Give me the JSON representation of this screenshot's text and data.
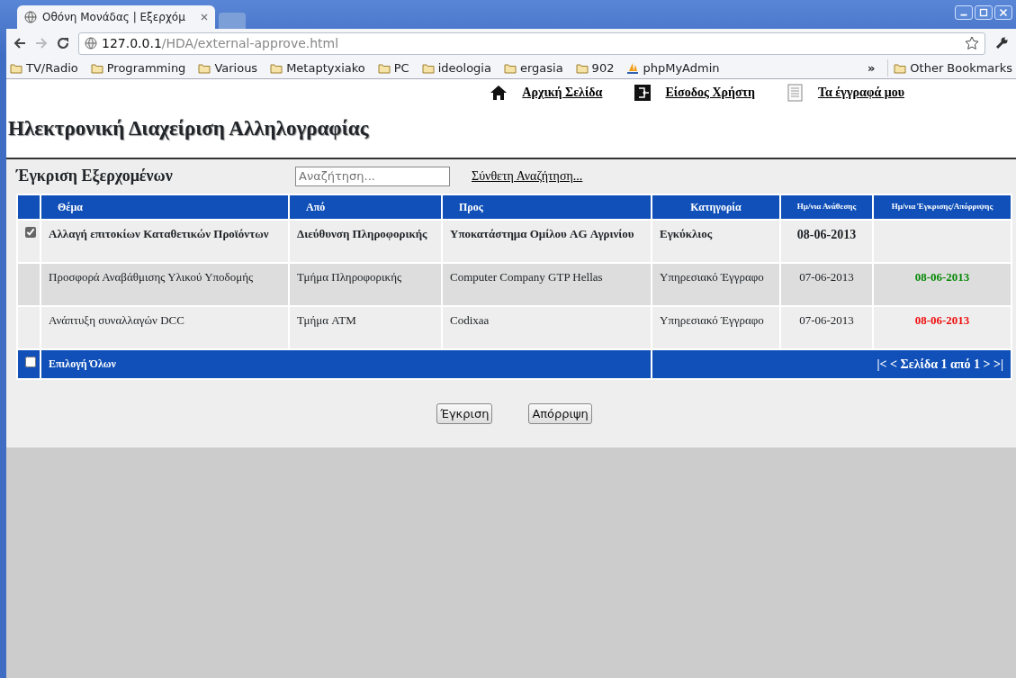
{
  "browser": {
    "tab_title": "Οθόνη Μονάδας | Εξερχόμ",
    "address": {
      "host": "127.0.0.1",
      "path": "/HDA/external-approve.html"
    },
    "bookmarks": [
      {
        "label": "TV/Radio",
        "kind": "folder"
      },
      {
        "label": "Programming",
        "kind": "folder"
      },
      {
        "label": "Various",
        "kind": "folder"
      },
      {
        "label": "Metaptyxiako",
        "kind": "folder"
      },
      {
        "label": "PC",
        "kind": "folder"
      },
      {
        "label": "ideologia",
        "kind": "folder"
      },
      {
        "label": "ergasia",
        "kind": "folder"
      },
      {
        "label": "902",
        "kind": "folder"
      },
      {
        "label": "phpMyAdmin",
        "kind": "app"
      }
    ],
    "overflow": "»",
    "other_bookmarks": "Other Bookmarks"
  },
  "top_nav": [
    {
      "label": "Αρχική Σελίδα",
      "kind": "home"
    },
    {
      "label": "Είσοδος Χρήστη",
      "kind": "login"
    },
    {
      "label": "Τα έγγραφά μου",
      "kind": "documents"
    }
  ],
  "site_title": "Ηλεκτρονική Διαχείριση Αλληλογραφίας",
  "section": {
    "title": "Έγκριση Εξερχομένων",
    "search": {
      "placeholder": "Αναζήτηση..."
    },
    "advanced_search": "Σύνθετη Αναζήτηση..."
  },
  "table": {
    "columns": [
      "Θέμα",
      "Από",
      "Προς",
      "Κατηγορία",
      "Ημ/νια Ανάθεσης",
      "Ημ/νια Έγκρισης/Απόρριψης"
    ],
    "rows": [
      {
        "checked": true,
        "unread": true,
        "highlighted": false,
        "subject": "Αλλαγή επιτοκίων Καταθετικών Προϊόντων",
        "from": "Διεύθυνση Πληροφορικής",
        "to": "Υποκατάστημα Ομίλου AG Αγρινίου",
        "category": "Εγκύκλιος",
        "assigned": "08-06-2013"
      },
      {
        "unread": false,
        "highlighted": true,
        "subject": "Προσφορά Αναβάθμισης Υλικού Υποδομής",
        "from": "Τμήμα Πληροφορικής",
        "to": "Computer Company GTP Hellas",
        "category": "Υπηρεσιακό Έγγραφο",
        "assigned": "07-06-2013",
        "decided": "08-06-2013",
        "color": "#0a8a0a"
      },
      {
        "unread": false,
        "highlighted": false,
        "subject": "Ανάπτυξη συναλλαγών DCC",
        "from": "Τμήμα ATM",
        "to": "Codixaa",
        "category": "Υπηρεσιακό Έγγραφο",
        "assigned": "07-06-2013",
        "decided": "08-06-2013",
        "color": "#f01010"
      }
    ],
    "footer": {
      "select_all": {
        "label": "Επιλογή Όλων",
        "checked": false
      },
      "pager": "|< < Σελίδα 1 από 1 > >|"
    }
  },
  "buttons": [
    "Έγκριση",
    "Απόρριψη"
  ]
}
